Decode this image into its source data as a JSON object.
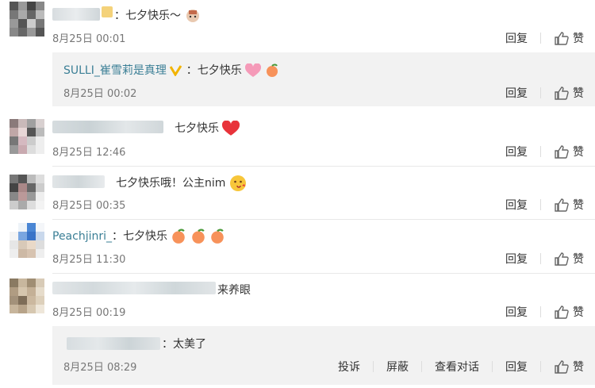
{
  "comments": [
    {
      "text": "：七夕快乐～",
      "time": "8月25日 00:01"
    },
    {
      "user": "SULLI_崔雪莉是真理",
      "text": "：七夕快乐",
      "time": "8月25日 00:02"
    },
    {
      "text": "七夕快乐",
      "time": "8月25日 12:46"
    },
    {
      "text": "七夕快乐哦！公主nim",
      "time": "8月25日 00:35"
    },
    {
      "user": "Peachjinri_",
      "text": "：七夕快乐",
      "time": "8月25日 11:30"
    },
    {
      "text": "来养眼",
      "time": "8月25日 00:19"
    },
    {
      "text": "：太美了",
      "time": "8月25日 08:29"
    }
  ],
  "actions": {
    "reply": "回复",
    "like": "赞",
    "report": "投诉",
    "block": "屏蔽",
    "view_dialog": "查看对话"
  },
  "colors": {
    "link": "#3b7f96",
    "reply_bg": "#f2f2f2",
    "time": "#777777"
  },
  "icons": [
    "thumbs-up-icon",
    "heart-icon",
    "peach-icon",
    "verified-v-icon",
    "kiss-face-icon"
  ]
}
